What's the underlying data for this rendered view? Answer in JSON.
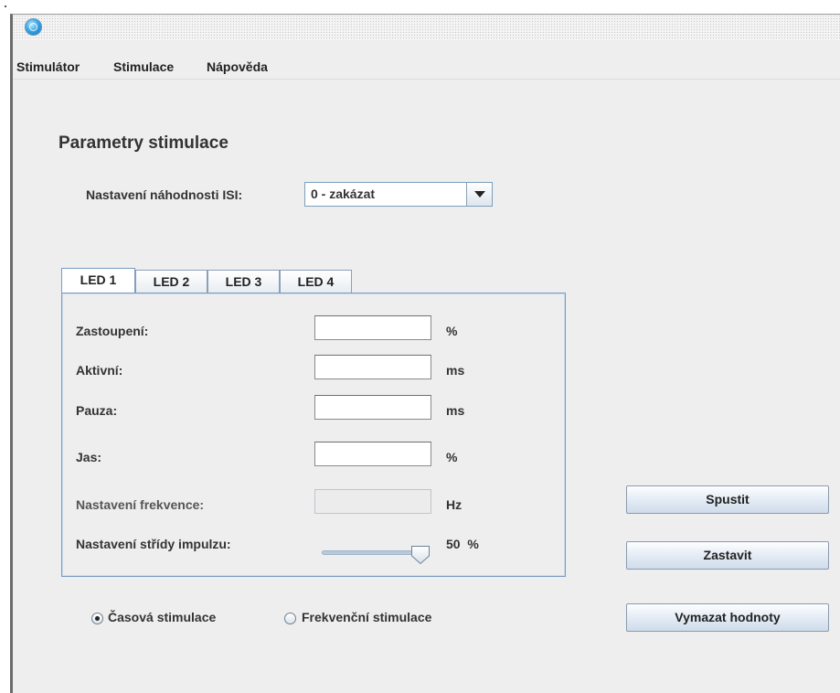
{
  "menu": {
    "items": [
      "Stimulátor",
      "Stimulace",
      "Nápověda"
    ]
  },
  "main": {
    "title": "Parametry stimulace",
    "isi": {
      "label": "Nastavení náhodnosti ISI:",
      "selected": "0 - zakázat"
    },
    "tabs": [
      "LED 1",
      "LED 2",
      "LED 3",
      "LED 4"
    ],
    "active_tab": "LED 1",
    "fields": [
      {
        "label": "Zastoupení:",
        "value": "",
        "unit": "%"
      },
      {
        "label": "Aktivní:",
        "value": "",
        "unit": "ms"
      },
      {
        "label": "Pauza:",
        "value": "",
        "unit": "ms"
      },
      {
        "label": "Jas:",
        "value": "",
        "unit": "%"
      }
    ],
    "frequency": {
      "label": "Nastavení frekvence:",
      "value": "",
      "unit": "Hz",
      "enabled": false
    },
    "duty": {
      "label": "Nastavení střídy impulzu:",
      "value": 50,
      "display": "50  %"
    },
    "radios": [
      {
        "label": "Časová stimulace",
        "checked": true
      },
      {
        "label": "Frekvenční stimulace",
        "checked": false
      }
    ],
    "buttons": {
      "start": "Spustit",
      "stop": "Zastavit",
      "clear": "Vymazat hodnoty"
    }
  },
  "colors": {
    "window_bg": "#eeeeee",
    "accent_border": "#7a9bc0",
    "button_top": "#fdfeff",
    "button_bottom": "#cfdcea"
  },
  "icons": {
    "app": "globe-icon",
    "combo": "chevron-down-icon",
    "slider": "slider-thumb-icon"
  }
}
